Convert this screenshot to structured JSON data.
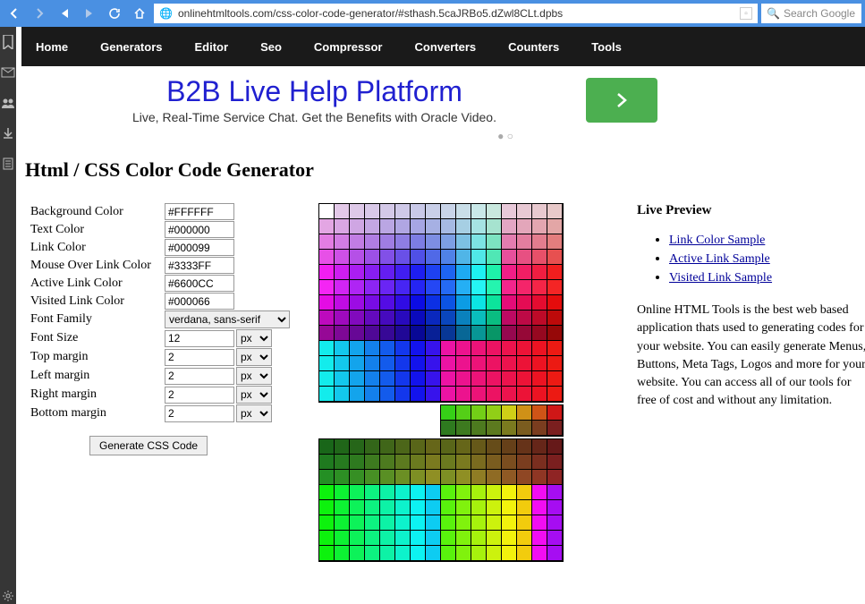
{
  "browser": {
    "url": "onlinehtmltools.com/css-color-code-generator/#sthash.5caJRBo5.dZwl8CLt.dpbs",
    "search_placeholder": "Search Google"
  },
  "nav": [
    "Home",
    "Generators",
    "Editor",
    "Seo",
    "Compressor",
    "Converters",
    "Counters",
    "Tools"
  ],
  "ad": {
    "title": "B2B Live Help Platform",
    "sub": "Live, Real-Time Service Chat. Get the Benefits with Oracle Video."
  },
  "page_title": "Html / CSS Color Code Generator",
  "form": {
    "rows": [
      {
        "label": "Background Color",
        "value": "#FFFFFF"
      },
      {
        "label": "Text Color",
        "value": "#000000"
      },
      {
        "label": "Link Color",
        "value": "#000099"
      },
      {
        "label": "Mouse Over Link Color",
        "value": "#3333FF"
      },
      {
        "label": "Active Link Color",
        "value": "#6600CC"
      },
      {
        "label": "Visited Link Color",
        "value": "#000066"
      }
    ],
    "font_family_label": "Font Family",
    "font_family_value": "verdana, sans-serif",
    "size_rows": [
      {
        "label": "Font Size",
        "value": "12",
        "unit": "px"
      },
      {
        "label": "Top margin",
        "value": "2",
        "unit": "px"
      },
      {
        "label": "Left margin",
        "value": "2",
        "unit": "px"
      },
      {
        "label": "Right margin",
        "value": "2",
        "unit": "px"
      },
      {
        "label": "Bottom margin",
        "value": "2",
        "unit": "px"
      }
    ],
    "button": "Generate CSS Code"
  },
  "preview": {
    "title": "Live Preview",
    "links": [
      "Link Color Sample",
      "Active Link Sample",
      "Visited Link Sample"
    ],
    "desc": "Online HTML Tools is the best web based application thats used to generating codes for your website. You can easily generate Menus, Buttons, Meta Tags, Logos and more for your website. You can access all of our tools for free of cost and without any limitation."
  }
}
